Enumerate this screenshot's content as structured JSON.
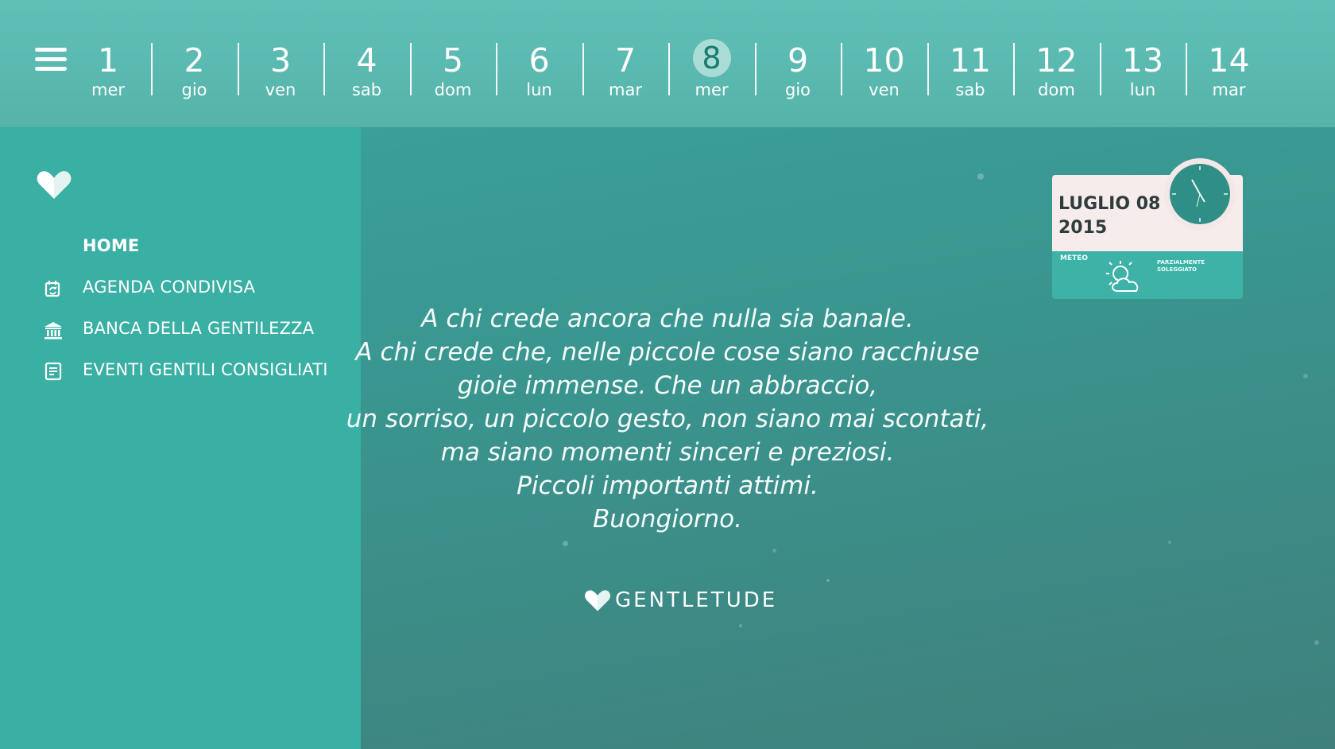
{
  "datebar": {
    "days": [
      {
        "num": "1",
        "weekday": "mer"
      },
      {
        "num": "2",
        "weekday": "gio"
      },
      {
        "num": "3",
        "weekday": "ven"
      },
      {
        "num": "4",
        "weekday": "sab"
      },
      {
        "num": "5",
        "weekday": "dom"
      },
      {
        "num": "6",
        "weekday": "lun"
      },
      {
        "num": "7",
        "weekday": "mar"
      },
      {
        "num": "8",
        "weekday": "mer",
        "selected": true
      },
      {
        "num": "9",
        "weekday": "gio"
      },
      {
        "num": "10",
        "weekday": "ven"
      },
      {
        "num": "11",
        "weekday": "sab"
      },
      {
        "num": "12",
        "weekday": "dom"
      },
      {
        "num": "13",
        "weekday": "lun"
      },
      {
        "num": "14",
        "weekday": "mar"
      }
    ]
  },
  "sidebar": {
    "items": [
      {
        "label": "HOME",
        "icon": "none",
        "active": true
      },
      {
        "label": "AGENDA CONDIVISA",
        "icon": "calendar-sync-icon"
      },
      {
        "label": "BANCA DELLA GENTILEZZA",
        "icon": "bank-icon"
      },
      {
        "label": "EVENTI GENTILI CONSIGLIATI",
        "icon": "document-icon"
      }
    ]
  },
  "quote": {
    "lines": [
      "A chi crede ancora che nulla sia banale.",
      "A chi crede che, nelle piccole cose siano racchiuse",
      "gioie immense. Che un abbraccio,",
      "un sorriso, un piccolo gesto, non siano mai scontati,",
      "ma siano momenti sinceri e preziosi.",
      "Piccoli importanti attimi.",
      "Buongiorno."
    ]
  },
  "brand": {
    "name": "GENTLETUDE"
  },
  "widget": {
    "date_line1": "LUGLIO 08",
    "date_line2": "2015",
    "meteo_label": "METEO",
    "meteo_desc_line1": "PARZIALMENTE",
    "meteo_desc_line2": "SOLEGGIATO",
    "meteo_icon": "partly-sunny-icon"
  },
  "colors": {
    "datebar": "#5fc0b7",
    "sidebar": "#3aafa4",
    "background": "#3a9690",
    "selected_day_circle": "#a8dcd5"
  }
}
